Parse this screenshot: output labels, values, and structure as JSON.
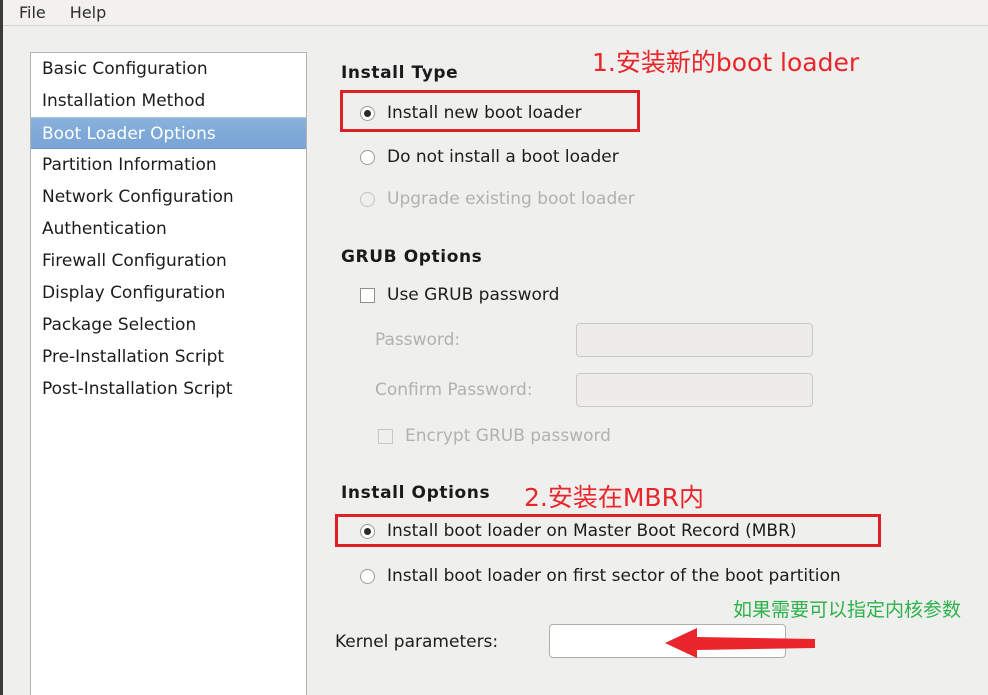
{
  "menubar": {
    "items": [
      {
        "label": "File"
      },
      {
        "label": "Help"
      }
    ]
  },
  "sidebar": {
    "items": [
      {
        "label": "Basic Configuration",
        "selected": false
      },
      {
        "label": "Installation Method",
        "selected": false
      },
      {
        "label": "Boot Loader Options",
        "selected": true
      },
      {
        "label": "Partition Information",
        "selected": false
      },
      {
        "label": "Network Configuration",
        "selected": false
      },
      {
        "label": "Authentication",
        "selected": false
      },
      {
        "label": "Firewall Configuration",
        "selected": false
      },
      {
        "label": "Display Configuration",
        "selected": false
      },
      {
        "label": "Package Selection",
        "selected": false
      },
      {
        "label": "Pre-Installation Script",
        "selected": false
      },
      {
        "label": "Post-Installation Script",
        "selected": false
      }
    ]
  },
  "install_type": {
    "title": "Install Type",
    "options": [
      {
        "label": "Install new boot loader",
        "checked": true,
        "disabled": false
      },
      {
        "label": "Do not install a boot loader",
        "checked": false,
        "disabled": false
      },
      {
        "label": "Upgrade existing boot loader",
        "checked": false,
        "disabled": true
      }
    ]
  },
  "grub_options": {
    "title": "GRUB Options",
    "use_grub_password": {
      "label": "Use GRUB password",
      "checked": false
    },
    "password": {
      "label": "Password:",
      "value": "",
      "disabled": true
    },
    "confirm_password": {
      "label": "Confirm Password:",
      "value": "",
      "disabled": true
    },
    "encrypt": {
      "label": "Encrypt GRUB password",
      "checked": false,
      "disabled": true
    }
  },
  "install_options": {
    "title": "Install Options",
    "options": [
      {
        "label": "Install boot loader on Master Boot Record (MBR)",
        "checked": true
      },
      {
        "label": "Install boot loader on first sector of the boot partition",
        "checked": false
      }
    ],
    "kernel_parameters": {
      "label": "Kernel parameters:",
      "value": ""
    }
  },
  "annotations": {
    "red_color": "#e8262b",
    "green_color": "#2cb24b",
    "box_color": "#dd1f26",
    "note_install_type": "1.安装新的boot loader",
    "note_install_options": "2.安装在MBR内",
    "note_kernel_parameters": "如果需要可以指定内核参数"
  }
}
